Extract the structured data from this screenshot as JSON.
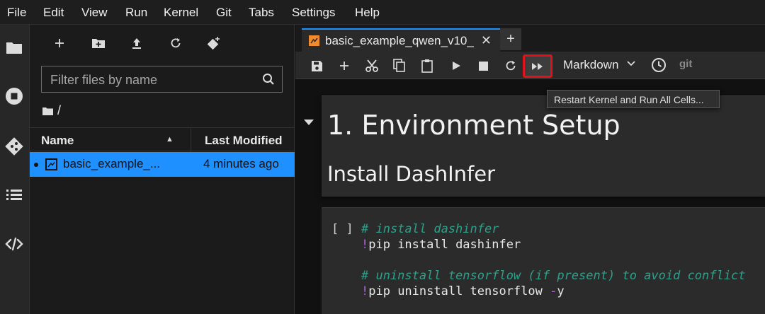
{
  "menu": [
    "File",
    "Edit",
    "View",
    "Run",
    "Kernel",
    "Git",
    "Tabs",
    "Settings",
    "Help"
  ],
  "activity_icons": [
    "folder-icon",
    "running-icon",
    "git-icon",
    "toc-icon",
    "extension-code-icon"
  ],
  "file_browser": {
    "toolbar_icons": [
      "new-launcher-icon",
      "new-folder-icon",
      "upload-icon",
      "refresh-icon",
      "git-clone-icon"
    ],
    "filter_placeholder": "Filter files by name",
    "breadcrumb": "/",
    "columns": {
      "name": "Name",
      "modified": "Last Modified"
    },
    "files": [
      {
        "name": "basic_example_...",
        "modified": "4 minutes ago",
        "selected": true
      }
    ]
  },
  "tab": {
    "title": "basic_example_qwen_v10_",
    "close": "✕",
    "new_tab": "+"
  },
  "toolbar": {
    "cell_type": "Markdown",
    "git_label": "git",
    "tooltip": "Restart Kernel and Run All Cells..."
  },
  "notebook": {
    "heading1": "1. Environment Setup",
    "heading2": "Install DashInfer",
    "code_prompt": "[ ]",
    "code": {
      "line1_comment": "# install dashinfer",
      "line2_bang": "!",
      "line2_text": "pip install dashinfer",
      "line4_comment": "# uninstall tensorflow (if present) to avoid conflict",
      "line5_bang": "!",
      "line5_text": "pip uninstall tensorflow ",
      "line5_flag": "-",
      "line5_tail": "y"
    }
  },
  "colors": {
    "accent": "#1e90ff",
    "highlight_box": "#e0121b",
    "comment": "#2f9f8a",
    "magic": "#b05bd8"
  }
}
